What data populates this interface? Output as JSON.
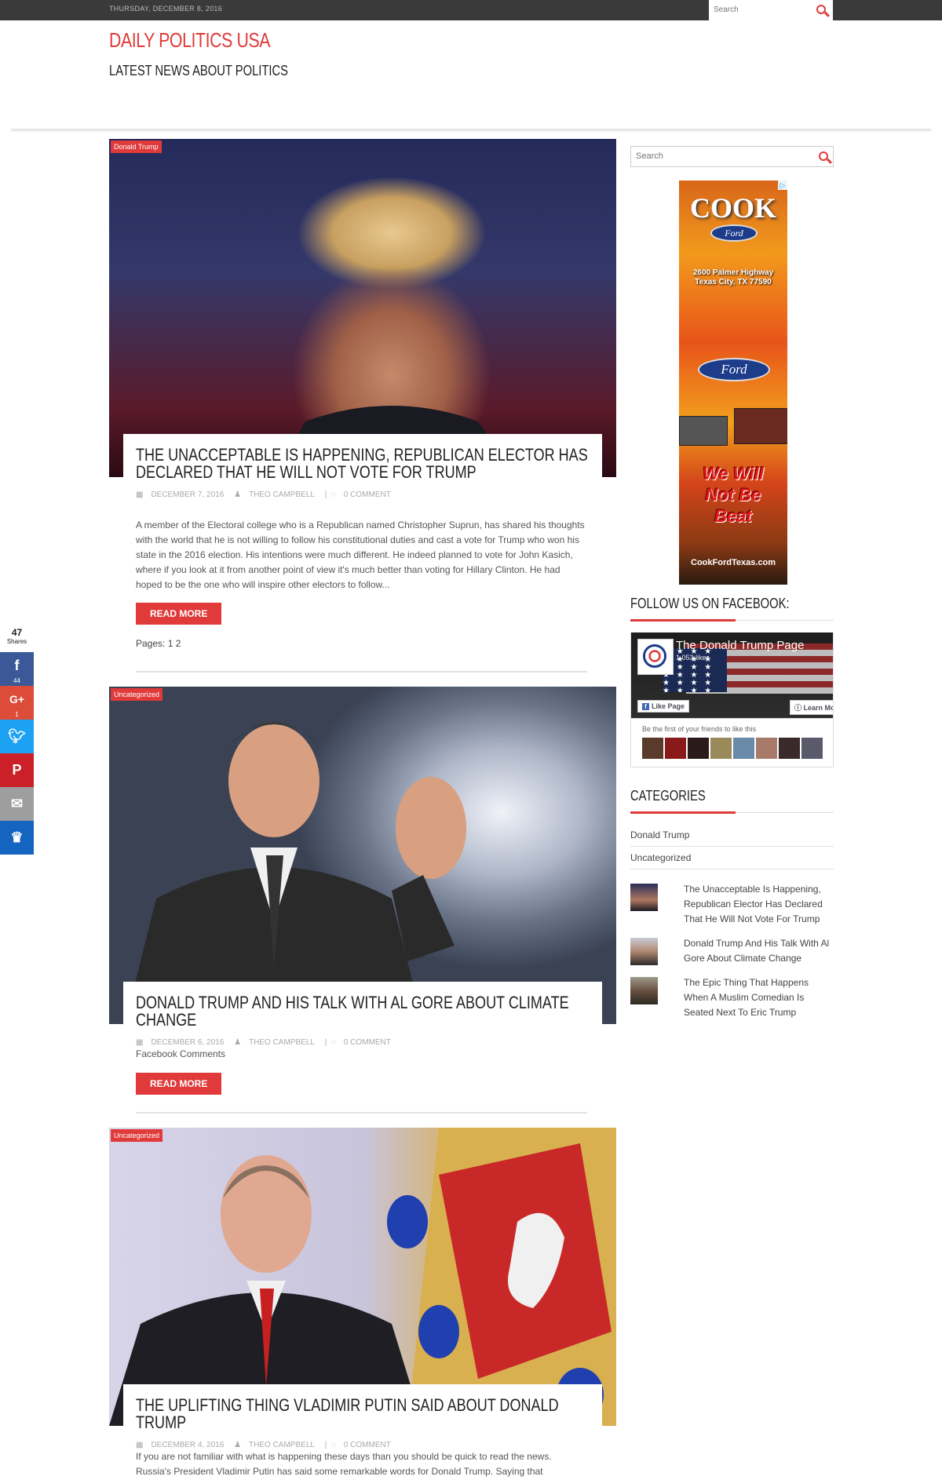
{
  "topbar": {
    "date": "THURSDAY, DECEMBER 8, 2016",
    "search_placeholder": "Search"
  },
  "site": {
    "title": "DAILY POLITICS USA",
    "tagline": "LATEST NEWS ABOUT POLITICS"
  },
  "posts": [
    {
      "category": "Donald Trump",
      "title": "THE UNACCEPTABLE IS HAPPENING, REPUBLICAN ELECTOR HAS DECLARED THAT HE WILL NOT VOTE FOR TRUMP",
      "date": "DECEMBER 7, 2016",
      "author": "THEO CAMPBELL",
      "comments": "0 COMMENT",
      "excerpt": "A member of the Electoral college who is a Republican named Christopher Suprun, has shared his thoughts with the world that he is not willing to follow his constitutional duties and cast a vote for Trump who won his state in the 2016 election. His intentions were much different. He indeed planned to vote for John Kasich, where if you look at it from another point of view it's much better than voting for Hillary Clinton. He had hoped to be the one who will inspire other electors to follow...",
      "read_more": "READ MORE",
      "pages": "Pages: 1 2"
    },
    {
      "category": "Uncategorized",
      "title": "DONALD TRUMP AND HIS TALK WITH AL GORE ABOUT CLIMATE CHANGE",
      "date": "DECEMBER 6, 2016",
      "author": "THEO CAMPBELL",
      "comments": "0 COMMENT",
      "excerpt": "Facebook Comments",
      "read_more": "READ MORE"
    },
    {
      "category": "Uncategorized",
      "title": "THE UPLIFTING THING VLADIMIR PUTIN SAID ABOUT DONALD TRUMP",
      "date": "DECEMBER 4, 2016",
      "author": "THEO CAMPBELL",
      "comments": "0 COMMENT",
      "excerpt": "If you are not familiar with what is happening these days than you should be quick to read the news. Russia's President Vladimir Putin has said some remarkable words for Donald Trump. Saying that"
    }
  ],
  "sidebar": {
    "search_placeholder": "Search",
    "ad": {
      "brand": "COOK",
      "ford": "Ford",
      "address_line1": "2600 Palmer Highway",
      "address_line2": "Texas City, TX 77590",
      "slogan_line1": "We Will",
      "slogan_line2": "Not Be",
      "slogan_line3": "Beat",
      "url": "CookFordTexas.com"
    },
    "facebook": {
      "title": "FOLLOW US ON FACEBOOK:",
      "page_name": "The Donald Trump Page",
      "likes": "1,053 likes",
      "like_button": "Like Page",
      "learn_button": "Learn More",
      "friends_text": "Be the first of your friends to like this"
    },
    "categories": {
      "title": "CATEGORIES",
      "items": [
        "Donald Trump",
        "Uncategorized"
      ]
    },
    "recent_posts": [
      "The Unacceptable Is Happening, Republican Elector Has Declared That He Will Not Vote For Trump",
      "Donald Trump And His Talk With Al Gore About Climate Change",
      "The Epic Thing That Happens When A Muslim Comedian Is Seated Next To Eric Trump"
    ]
  },
  "share": {
    "total": "47",
    "label": "Shares",
    "facebook_count": "44",
    "google_count": "1",
    "colors": {
      "facebook": "#3b5998",
      "google": "#dd4b39",
      "twitter": "#1da1f2",
      "pinterest": "#cb2027",
      "email": "#9e9e9e",
      "sumo": "#1565c0"
    }
  }
}
